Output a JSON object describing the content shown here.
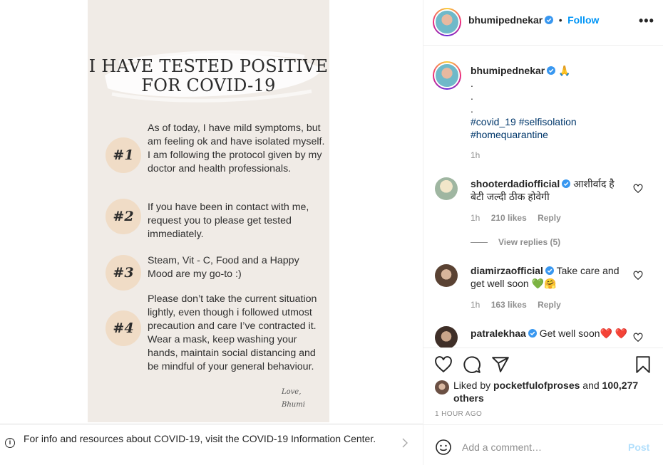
{
  "post_image": {
    "title_line1": "I HAVE TESTED POSITIVE",
    "title_line2": "FOR COVID-19",
    "points": [
      {
        "num": "#1",
        "text": "As of today, I have mild symptoms, but am feeling ok and have isolated myself. I am following the protocol given by my doctor and health professionals."
      },
      {
        "num": "#2",
        "text": "If you have been in contact with me, request you to please get tested immediately."
      },
      {
        "num": "#3",
        "text": "Steam, Vit - C, Food and a Happy Mood are my go-to :)"
      },
      {
        "num": "#4",
        "text": "Please don’t take the current situation lightly, even though i followed utmost precaution and care I’ve contracted it. Wear a mask, keep washing your hands, maintain social distancing and be mindful of your general behaviour."
      }
    ],
    "signature_line1": "Love,",
    "signature_line2": "Bhumi"
  },
  "info_banner": {
    "text": "For info and resources about COVID-19, visit the COVID-19 Information Center."
  },
  "header": {
    "username": "bhumipednekar",
    "separator": "•",
    "follow_label": "Follow",
    "more_label": "•••"
  },
  "caption": {
    "username": "bhumipednekar",
    "emoji": "🙏",
    "dot1": ".",
    "dot2": ".",
    "dot3": ".",
    "tag1": "#covid_19",
    "tag2": "#selfisolation",
    "tag3": "#homequarantine",
    "time": "1h"
  },
  "comments": [
    {
      "username": "shooterdadiofficial",
      "text": "आशीर्वाद है बेटी जल्दी ठीक होवेगी",
      "time": "1h",
      "likes": "210 likes",
      "reply": "Reply",
      "view_replies": "View replies (5)"
    },
    {
      "username": "diamirzaofficial",
      "text": "Take care and get well soon 💚🤗",
      "time": "1h",
      "likes": "163 likes",
      "reply": "Reply"
    },
    {
      "username": "patralekhaa",
      "text": "Get well soon❤️ ❤️"
    }
  ],
  "likes": {
    "prefix": "Liked by",
    "user": "pocketfulofproses",
    "and": "and",
    "count": "100,277 others"
  },
  "timestamp": "1 HOUR AGO",
  "add_comment": {
    "placeholder": "Add a comment…",
    "post_label": "Post"
  },
  "colors": {
    "accent": "#0095f6",
    "post_disabled": "#b2dffc",
    "image_bg": "#f0ebe6",
    "number_circle": "#f0dcc6",
    "verified": "#3897f0"
  },
  "icons": [
    "heart-icon",
    "comment-icon",
    "share-icon",
    "bookmark-icon",
    "emoji-icon",
    "info-icon",
    "chevron-right-icon",
    "verified-icon"
  ]
}
